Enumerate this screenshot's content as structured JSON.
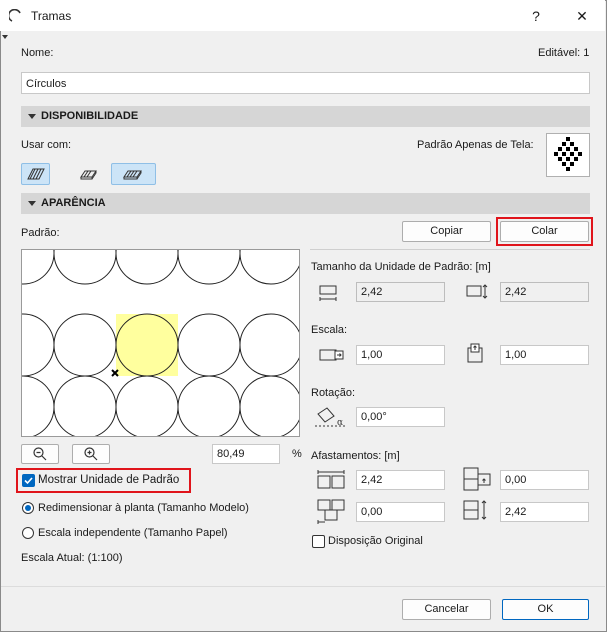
{
  "window": {
    "title": "Tramas",
    "help": "?",
    "close": "✕"
  },
  "name": {
    "label": "Nome:",
    "editable": "Editável: 1",
    "value": "Círculos"
  },
  "availability": {
    "header": "DISPONIBILIDADE",
    "use_with": "Usar com:",
    "screen_only": "Padrão Apenas de Tela:"
  },
  "appearance": {
    "header": "APARÊNCIA",
    "pattern_label": "Padrão:",
    "copy": "Copiar",
    "paste": "Colar",
    "zoom_value": "80,49",
    "zoom_unit": "%",
    "show_unit": "Mostrar Unidade de Padrão",
    "resize_plan": "Redimensionar à planta (Tamanho Modelo)",
    "independent_scale": "Escala independente (Tamanho Papel)",
    "current_scale": "Escala Atual: (1:100)"
  },
  "unit_size": {
    "label": "Tamanho da Unidade de Padrão: [m]",
    "width": "2,42",
    "height": "2,42"
  },
  "scale": {
    "label": "Escala:",
    "x": "1,00",
    "y": "1,00"
  },
  "rotation": {
    "label": "Rotação:",
    "value": "0,00°"
  },
  "offsets": {
    "label": "Afastamentos: [m]",
    "a": "2,42",
    "b": "0,00",
    "c": "0,00",
    "d": "2,42"
  },
  "original_layout": "Disposição Original",
  "footer": {
    "cancel": "Cancelar",
    "ok": "OK"
  },
  "colors": {
    "accent": "#0067c0",
    "highlight": "#ffff9e",
    "red": "#e0141b"
  }
}
